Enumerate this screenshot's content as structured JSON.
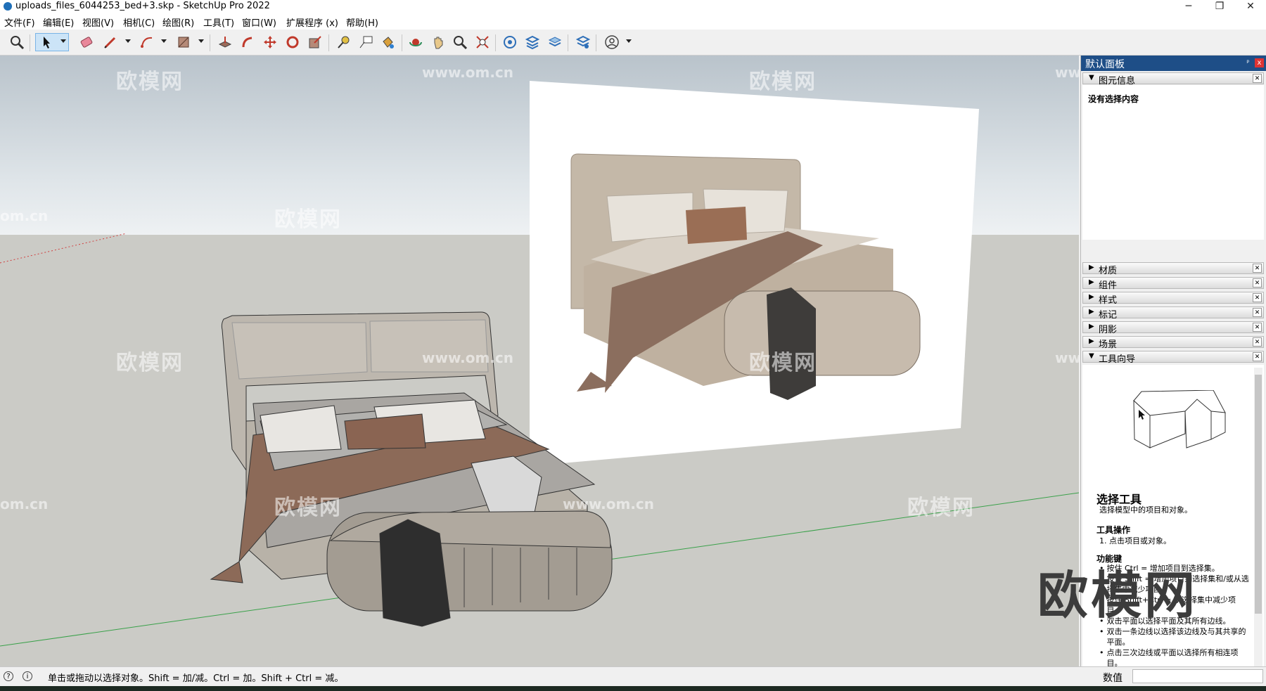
{
  "window": {
    "title": "uploads_files_6044253_bed+3.skp - SketchUp Pro 2022",
    "minimize": "─",
    "maximize": "❐",
    "close": "✕"
  },
  "menubar": [
    "文件(F)",
    "编辑(E)",
    "视图(V)",
    "相机(C)",
    "绘图(R)",
    "工具(T)",
    "窗口(W)",
    "扩展程序 (x)",
    "帮助(H)"
  ],
  "toolbar": {
    "tools": [
      "zoom-icon",
      "select-icon",
      "eraser-icon",
      "pencil-icon",
      "arc-icon",
      "rectangle-icon",
      "push-pull-icon",
      "follow-me-icon",
      "move-icon",
      "rotate-icon",
      "scale-icon",
      "tape-measure-icon",
      "text-icon",
      "paint-bucket-icon",
      "orbit-icon",
      "pan-icon",
      "zoom-window-icon",
      "zoom-extents-icon",
      "warehouse-icon",
      "extension-icon",
      "layers-icon",
      "extension-manager-icon",
      "account-icon"
    ],
    "active_tool": "select-icon"
  },
  "viewport": {
    "watermarks": [
      "欧模网",
      "www.om.cn",
      "om.cn"
    ],
    "big_watermark": "欧模网"
  },
  "panel": {
    "title": "默认面板",
    "pin": "ᵖ",
    "close": "x",
    "entity_info": {
      "label": "图元信息",
      "empty_message": "没有选择内容"
    },
    "sections": [
      "材质",
      "组件",
      "样式",
      "标记",
      "阴影",
      "场景"
    ],
    "instructor": {
      "label": "工具向导",
      "tool_name": "选择工具",
      "description": "选择模型中的项目和对象。",
      "operations_heading": "工具操作",
      "operations": [
        "1. 点击项目或对象。"
      ],
      "modifier_heading": "功能键",
      "modifiers": [
        "按住 Ctrl = 增加项目到选择集。",
        "按住 Shift = 增加项目到选择集和/或从选择集中减少项目。",
        "按住 Shift+Ctrl = 从选择集中减少项目。",
        "双击平面以选择平面及其所有边线。",
        "双击一条边线以选择该边线及与其共享的平面。",
        "点击三次边线或平面以选择所有相连项目。"
      ]
    }
  },
  "statusbar": {
    "message": "单击或拖动以选择对象。Shift = 加/减。Ctrl = 加。Shift + Ctrl = 减。",
    "measurements_label": "数值",
    "measurements_value": ""
  },
  "colors": {
    "panel_title_bg": "#1e4e87",
    "active_tool_bg": "#cce4f7",
    "ground": "#cbcbc6",
    "sky": "#dfe5e9",
    "green_axis": "#3aa14a",
    "red_axis": "#d04040"
  }
}
